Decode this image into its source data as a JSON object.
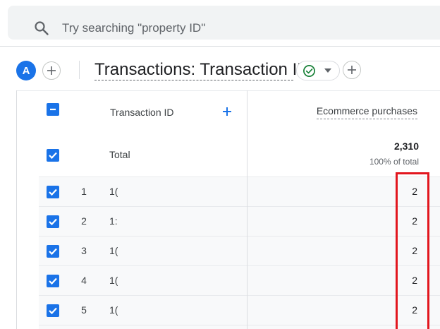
{
  "search": {
    "placeholder": "Try searching \"property ID\""
  },
  "header": {
    "avatar_letter": "A",
    "report_title": "Transactions: Transaction ID"
  },
  "table": {
    "dimension_header": "Transaction ID",
    "metric_header": "Ecommerce purchases",
    "total": {
      "label": "Total",
      "value": "2,310",
      "percent": "100% of total"
    },
    "rows": [
      {
        "index": "1",
        "id": "1(",
        "value": "2"
      },
      {
        "index": "2",
        "id": "1:",
        "value": "2"
      },
      {
        "index": "3",
        "id": "1(",
        "value": "2"
      },
      {
        "index": "4",
        "id": "1(",
        "value": "2"
      },
      {
        "index": "5",
        "id": "1(",
        "value": "2"
      }
    ]
  },
  "colors": {
    "accent": "#1a73e8",
    "highlight": "#e2161e",
    "success": "#188038"
  },
  "icons": [
    "search-icon",
    "add-icon",
    "check-circle-icon",
    "dropdown-arrow-icon",
    "checkbox-checked-icon",
    "checkbox-indeterminate-icon"
  ]
}
